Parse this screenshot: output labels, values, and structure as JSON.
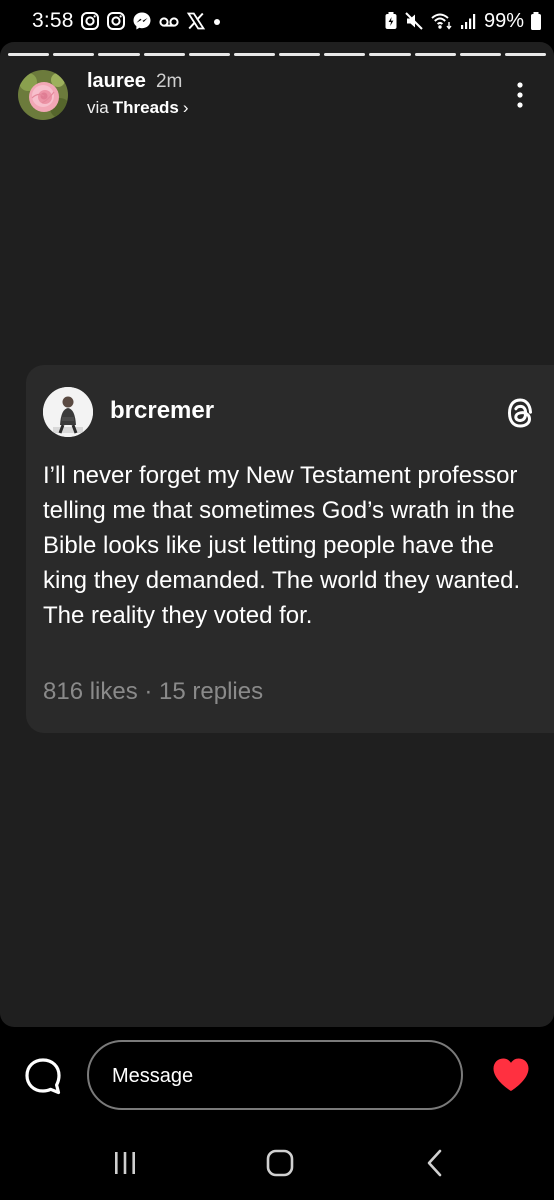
{
  "status_bar": {
    "time": "3:58",
    "battery": "99%",
    "left_icons": [
      "instagram-icon",
      "instagram-icon",
      "messenger-icon",
      "voicemail-icon",
      "x-icon",
      "dot-icon"
    ],
    "right_icons": [
      "battery-saver-icon",
      "mute-icon",
      "wifi-icon",
      "signal-icon",
      "battery-icon"
    ]
  },
  "story": {
    "progress_segments": 12,
    "username": "lauree",
    "time_ago": "2m",
    "via_prefix": "via",
    "via_app": "Threads",
    "via_chevron": "›"
  },
  "post": {
    "author": "brcremer",
    "text": "I’ll never forget my New Testament professor telling me that sometimes God’s wrath in the Bible looks like just letting people have the king they demanded. The world they wanted. The reality they voted for.",
    "stats": "816 likes · 15 replies"
  },
  "reply_bar": {
    "placeholder": "Message"
  },
  "colors": {
    "story_background": "#1f1f1f",
    "post_background": "#2a2a2a",
    "heart": "#ff3040",
    "muted_text": "#8a8a8a"
  }
}
